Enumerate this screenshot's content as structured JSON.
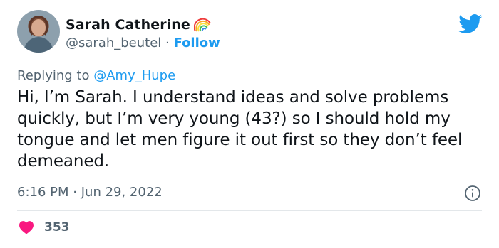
{
  "author": {
    "name": "Sarah Catherine",
    "handle": "@sarah_beutel",
    "separator": "·",
    "follow_label": "Follow"
  },
  "tweet": {
    "replying_prefix": "Replying to",
    "replying_to": "@Amy_Hupe",
    "text": "Hi, I’m Sarah. I understand ideas and solve problems quickly, but I’m very young (43?) so I should hold my tongue and let men figure it out first so they don’t feel demeaned.",
    "time": "6:16 PM",
    "date_separator": "·",
    "date": "Jun 29, 2022"
  },
  "engagement": {
    "likes": "353"
  },
  "colors": {
    "accent": "#1d9bf0",
    "heart": "#f91880",
    "secondary_text": "#536471"
  },
  "icons": {
    "brand": "twitter-bird-icon",
    "name_emoji": "rainbow-icon",
    "info": "info-icon",
    "like": "heart-icon"
  }
}
